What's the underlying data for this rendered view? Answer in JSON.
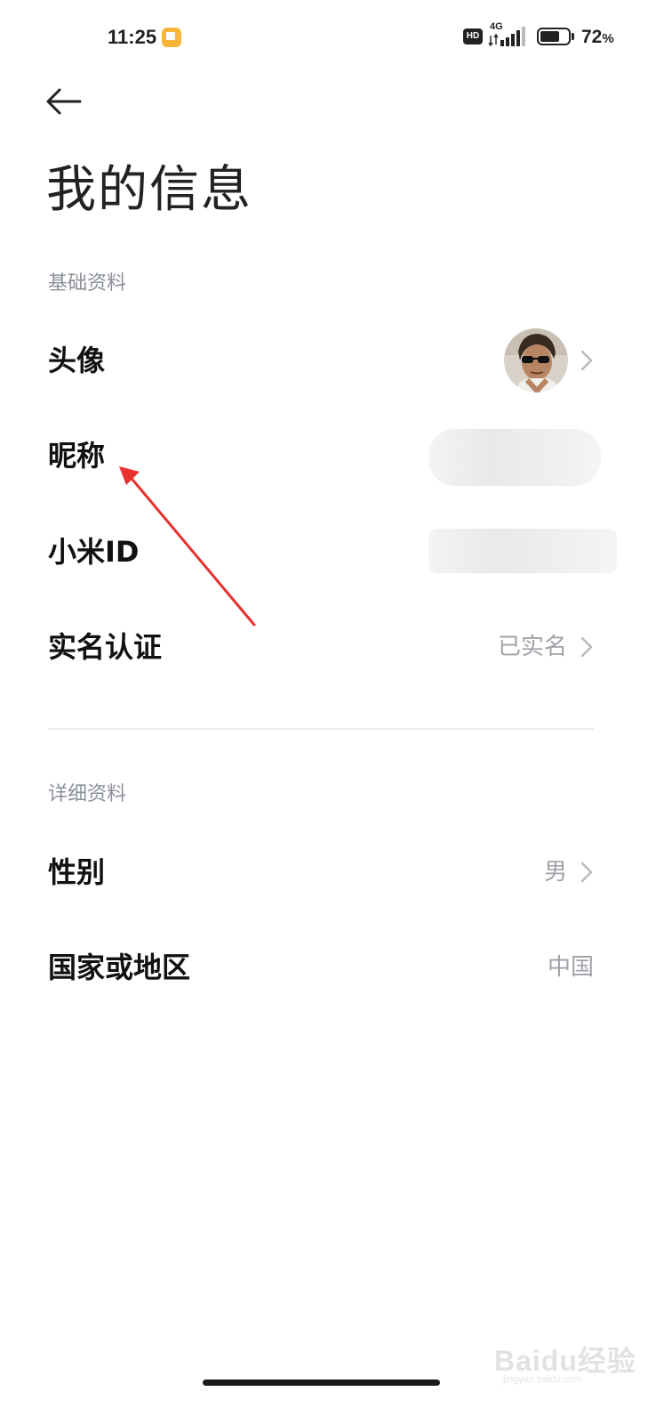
{
  "status_bar": {
    "time": "11:25",
    "hd_badge": "HD",
    "network": "4G",
    "battery_level": 72,
    "battery_number": "72",
    "battery_unit": "%"
  },
  "header": {
    "back_icon": "back-arrow-icon",
    "title": "我的信息"
  },
  "sections": {
    "basic": {
      "label": "基础资料",
      "rows": {
        "avatar": {
          "label": "头像"
        },
        "nickname": {
          "label": "昵称"
        },
        "mi_id": {
          "label": "小米ID"
        },
        "real_name": {
          "label": "实名认证",
          "value": "已实名"
        }
      }
    },
    "detail": {
      "label": "详细资料",
      "rows": {
        "gender": {
          "label": "性别",
          "value": "男"
        },
        "region": {
          "label": "国家或地区",
          "value": "中国"
        }
      }
    }
  },
  "watermark": {
    "text": "Baidu经验",
    "sub": "jingyan.baidu.com"
  },
  "colors": {
    "annotation_arrow": "#e8322f",
    "secondary_text": "#9ea2a8",
    "section_label": "#8a8f99"
  }
}
